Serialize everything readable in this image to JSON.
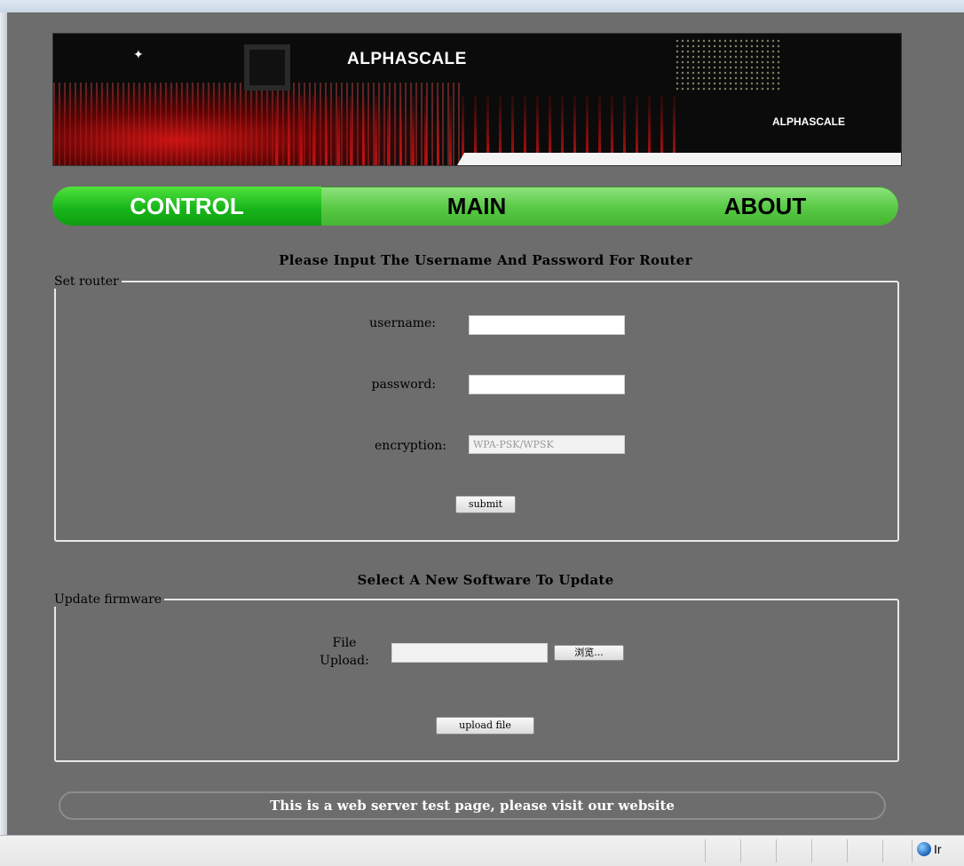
{
  "banner": {
    "logo_text": "ALPHASCALE",
    "logo_text_small": "ALPHASCALE"
  },
  "nav": {
    "tabs": [
      {
        "label": "CONTROL",
        "active": true
      },
      {
        "label": "MAIN",
        "active": false
      },
      {
        "label": "ABOUT",
        "active": false
      }
    ]
  },
  "router_section": {
    "heading": "Please Input The Username And Password For Router",
    "legend": "Set router",
    "username_label": "username:",
    "username_value": "",
    "password_label": "password:",
    "password_value": "",
    "encryption_label": "encryption:",
    "encryption_value": "WPA-PSK/WPSK",
    "submit_label": "submit"
  },
  "firmware_section": {
    "heading": "Select A New Software To Update",
    "legend": "Update firmware",
    "file_label_line1": "File",
    "file_label_line2": "Upload:",
    "file_value": "",
    "browse_label": "浏览...",
    "upload_label": "upload file"
  },
  "footer": {
    "text": "This is a web server test page, please visit our website"
  },
  "statusbar": {
    "zone_text": "Ir"
  }
}
